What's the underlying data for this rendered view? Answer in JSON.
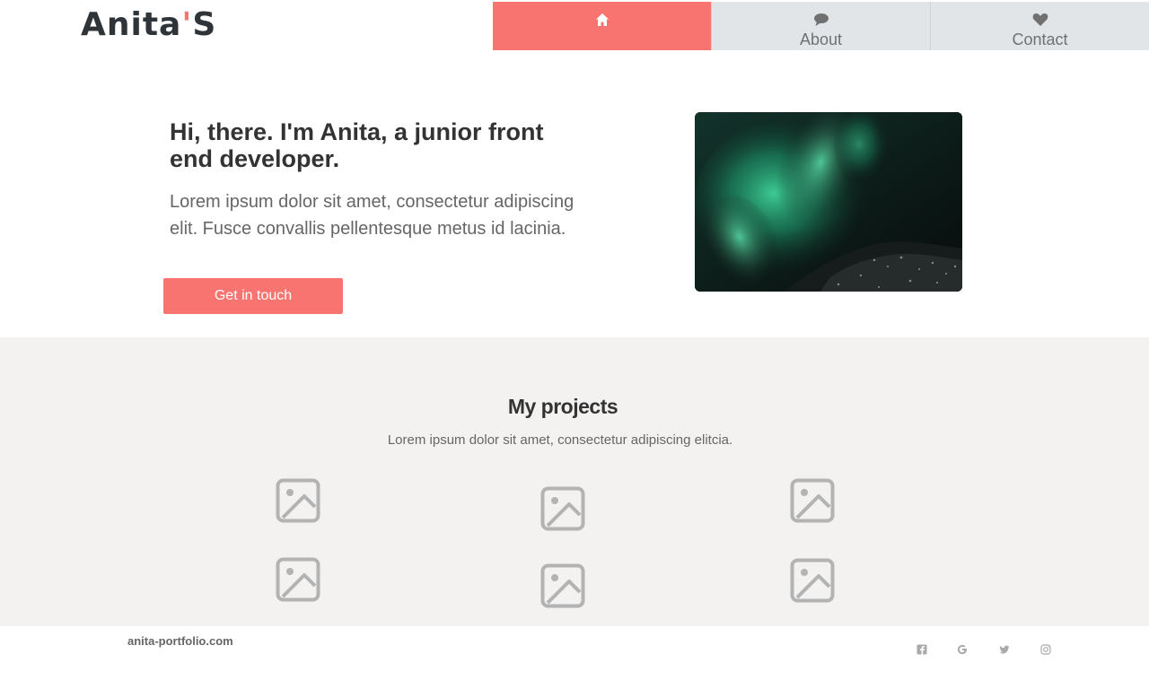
{
  "header": {
    "logo": {
      "name": "Anita",
      "apostrophe": "'",
      "suffix": "S"
    },
    "nav": [
      {
        "label": "",
        "icon": "home-icon",
        "active": true
      },
      {
        "label": "About",
        "icon": "comment-icon",
        "active": false
      },
      {
        "label": "Contact",
        "icon": "heart-icon",
        "active": false
      }
    ]
  },
  "hero": {
    "title": "Hi, there. I'm Anita, a junior front end developer.",
    "text": "Lorem ipsum dolor sit amet, consectetur adipiscing elit. Fusce convallis pellentesque metus id lacinia.",
    "cta_label": "Get in touch",
    "image_icon": "aurora-photo"
  },
  "projects": {
    "title": "My projects",
    "subtitle": "Lorem ipsum dolor sit amet, consectetur adipiscing elitcia.",
    "items": [
      {
        "icon": "image-placeholder-icon"
      },
      {
        "icon": "image-placeholder-icon"
      },
      {
        "icon": "image-placeholder-icon"
      },
      {
        "icon": "image-placeholder-icon"
      },
      {
        "icon": "image-placeholder-icon"
      },
      {
        "icon": "image-placeholder-icon"
      }
    ]
  },
  "footer": {
    "site": "anita-portfolio.com",
    "social": [
      "facebook-icon",
      "google-icon",
      "twitter-icon",
      "instagram-icon"
    ]
  },
  "colors": {
    "accent": "#f87470",
    "nav_bg": "#e2e5e8",
    "section_bg": "#f3f2f1",
    "placeholder_icon": "#b3b3b3"
  }
}
